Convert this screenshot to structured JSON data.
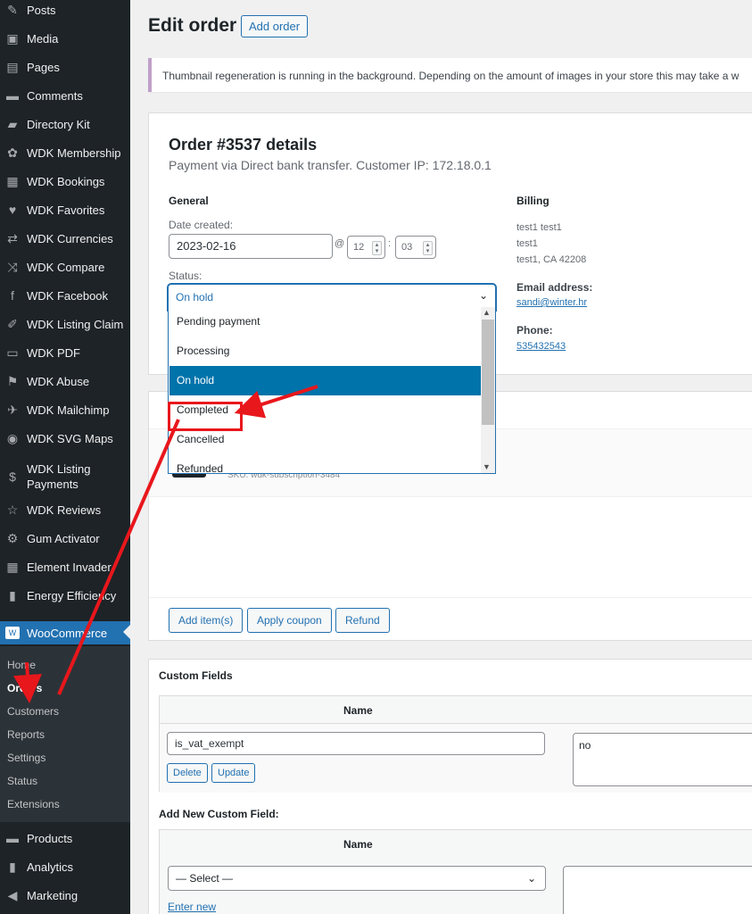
{
  "sidebar": {
    "items": [
      {
        "label": "Posts",
        "icon": "pin-icon",
        "glyph": "✎"
      },
      {
        "label": "Media",
        "icon": "media-icon",
        "glyph": "▣"
      },
      {
        "label": "Pages",
        "icon": "pages-icon",
        "glyph": "▤"
      },
      {
        "label": "Comments",
        "icon": "comment-icon",
        "glyph": "▬"
      },
      {
        "label": "Directory Kit",
        "icon": "folder-icon",
        "glyph": "▰"
      },
      {
        "label": "WDK Membership",
        "icon": "group-icon",
        "glyph": "✿"
      },
      {
        "label": "WDK Bookings",
        "icon": "calendar-icon",
        "glyph": "▦"
      },
      {
        "label": "WDK Favorites",
        "icon": "heart-icon",
        "glyph": "♥"
      },
      {
        "label": "WDK Currencies",
        "icon": "exchange-icon",
        "glyph": "⇄"
      },
      {
        "label": "WDK Compare",
        "icon": "shuffle-icon",
        "glyph": "⤨"
      },
      {
        "label": "WDK Facebook",
        "icon": "facebook-icon",
        "glyph": "f"
      },
      {
        "label": "WDK Listing Claim",
        "icon": "edit-icon",
        "glyph": "✐"
      },
      {
        "label": "WDK PDF",
        "icon": "pdf-icon",
        "glyph": "▭"
      },
      {
        "label": "WDK Abuse",
        "icon": "flag-icon",
        "glyph": "⚑"
      },
      {
        "label": "WDK Mailchimp",
        "icon": "send-icon",
        "glyph": "✈"
      },
      {
        "label": "WDK SVG Maps",
        "icon": "globe-icon",
        "glyph": "◉"
      },
      {
        "label": "WDK Listing Payments",
        "icon": "dollar-icon",
        "glyph": "$"
      },
      {
        "label": "WDK Reviews",
        "icon": "star-icon",
        "glyph": "☆"
      },
      {
        "label": "Gum Activator",
        "icon": "plugin-icon",
        "glyph": "⚙"
      },
      {
        "label": "Element Invader",
        "icon": "grid-icon",
        "glyph": "▦"
      },
      {
        "label": "Energy Efficiency",
        "icon": "chart-bar-icon",
        "glyph": "▮"
      },
      {
        "label": "WooCommerce",
        "icon": "woo-icon",
        "glyph": "W"
      },
      {
        "label": "Products",
        "icon": "box-icon",
        "glyph": "▬"
      },
      {
        "label": "Analytics",
        "icon": "analytics-icon",
        "glyph": "▮"
      },
      {
        "label": "Marketing",
        "icon": "megaphone-icon",
        "glyph": "◀"
      }
    ],
    "submenu": [
      "Home",
      "Orders",
      "Customers",
      "Reports",
      "Settings",
      "Status",
      "Extensions"
    ]
  },
  "header": {
    "title": "Edit order",
    "add_order": "Add order"
  },
  "notice": "Thumbnail regeneration is running in the background. Depending on the amount of images in your store this may take a w",
  "order": {
    "title": "Order #3537 details",
    "subtitle": "Payment via Direct bank transfer. Customer IP: 172.18.0.1",
    "general_heading": "General",
    "date_label": "Date created:",
    "date_value": "2023-02-16",
    "at": "@",
    "hour": "12",
    "colon": ":",
    "minute": "03",
    "status_label": "Status:",
    "billing_heading": "Billing",
    "billing_lines": [
      "test1 test1",
      "test1",
      "test1, CA 42208"
    ],
    "email_label": "Email address:",
    "email": "sandi@winter.hr",
    "phone_label": "Phone:",
    "phone": "535432543"
  },
  "status_dropdown": {
    "selected": "On hold",
    "options": [
      "Pending payment",
      "Processing",
      "On hold",
      "Completed",
      "Cancelled",
      "Refunded"
    ]
  },
  "items": {
    "sku": "SKU: wdk-subscription-3484",
    "add_items": "Add item(s)",
    "apply_coupon": "Apply coupon",
    "refund": "Refund"
  },
  "custom_fields": {
    "title": "Custom Fields",
    "name_header": "Name",
    "field_name": "is_vat_exempt",
    "field_value": "no",
    "delete": "Delete",
    "update": "Update",
    "add_new_label": "Add New Custom Field:",
    "select_placeholder": "— Select —",
    "enter_new": "Enter new"
  },
  "colors": {
    "sidebar_bg": "#1d2327",
    "accent": "#2271b1",
    "selected_option": "#0073aa",
    "annotation": "#e8171c"
  }
}
